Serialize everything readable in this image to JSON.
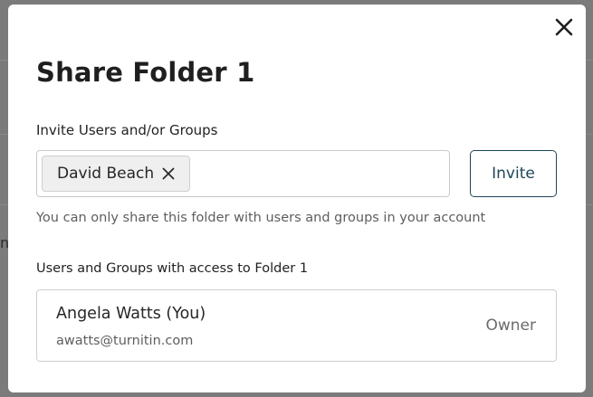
{
  "background": {
    "fragment_text": "n"
  },
  "modal": {
    "close_icon": "close-icon",
    "title": "Share Folder 1",
    "invite_label": "Invite Users and/or Groups",
    "chips": [
      {
        "label": "David Beach",
        "remove_icon": "close-icon"
      }
    ],
    "invite_button": "Invite",
    "helper_text": "You can only share this folder with users and groups in your account",
    "access_label": "Users and Groups with access to Folder 1",
    "users": [
      {
        "name": "Angela Watts (You)",
        "email": "awatts@turnitin.com",
        "role": "Owner"
      }
    ]
  },
  "colors": {
    "accent": "#1e4656",
    "overlay": "#7b7b7b",
    "text": "#1f1f1f",
    "muted": "#5e5e5e"
  }
}
